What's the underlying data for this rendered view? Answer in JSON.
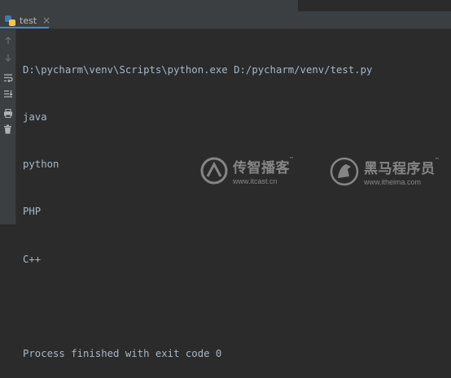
{
  "tab": {
    "title": "test",
    "close_glyph": "×"
  },
  "toolbar": {
    "icons": [
      "arrow-up-icon",
      "arrow-down-icon",
      "soft-wrap-icon",
      "scroll-to-end-icon",
      "print-icon",
      "trash-icon"
    ]
  },
  "console": {
    "lines": [
      "D:\\pycharm\\venv\\Scripts\\python.exe D:/pycharm/venv/test.py",
      "java",
      "python",
      "PHP",
      "C++",
      "",
      "Process finished with exit code 0"
    ]
  },
  "watermarks": [
    {
      "title": "传智播客",
      "tm": "™",
      "url": "www.itcast.cn"
    },
    {
      "title": "黑马程序员",
      "tm": "™",
      "url": "www.itheima.com"
    }
  ],
  "colors": {
    "background": "#2b2b2b",
    "panel": "#3c3f41",
    "text": "#a9b7c6",
    "tab_accent": "#4a88c7"
  }
}
